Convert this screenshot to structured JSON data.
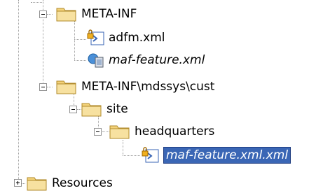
{
  "tree": {
    "meta_inf": "META-INF",
    "adfm_xml": "adfm.xml",
    "maf_feature_xml": "maf-feature.xml",
    "meta_inf_mdssys_cust": "META-INF\\mdssys\\cust",
    "site": "site",
    "headquarters": "headquarters",
    "maf_feature_xml_xml": "maf-feature.xml.xml",
    "resources": "Resources"
  },
  "colors": {
    "selection": "#3a66b5",
    "folder": "#f3d27a",
    "tree_lines": "#a0a0a0"
  },
  "icons": [
    "folder-icon",
    "xml-file-lock-icon",
    "feature-file-icon"
  ]
}
